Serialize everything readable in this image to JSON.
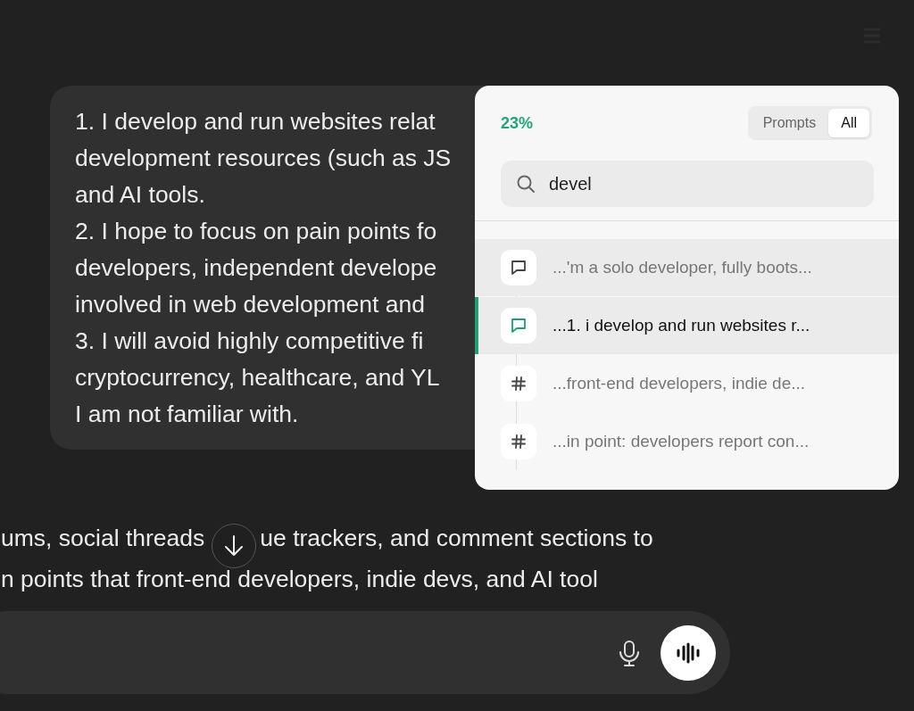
{
  "message": {
    "lines": [
      "1. I develop and run websites relat",
      "development resources (such as JS",
      "and AI tools.",
      "2. I hope to focus on pain points fo",
      "developers, independent develope",
      "involved in web development and",
      "3. I will avoid highly competitive fi",
      "cryptocurrency, healthcare, and YL",
      "I am not familiar with."
    ]
  },
  "response": {
    "lines": [
      [
        "ums, social threads",
        "ue trackers, and comment sections to"
      ],
      [
        "n points that front-end developers, indie devs, and AI tool"
      ]
    ]
  },
  "search_panel": {
    "progress": "23%",
    "tabs": [
      {
        "label": "Prompts",
        "selected": false
      },
      {
        "label": "All",
        "selected": true
      }
    ],
    "search": {
      "value": "devel"
    },
    "results": [
      {
        "kind": "prompt",
        "text": "...'m a solo developer, fully boots...",
        "selected": false,
        "hovered": true
      },
      {
        "kind": "prompt",
        "text": "...1. i develop and run websites r...",
        "selected": true,
        "hovered": false
      },
      {
        "kind": "heading",
        "text": "...front-end developers, indie de...",
        "selected": false,
        "hovered": false
      },
      {
        "kind": "heading",
        "text": "...in point: developers report con...",
        "selected": false,
        "hovered": false
      }
    ]
  }
}
